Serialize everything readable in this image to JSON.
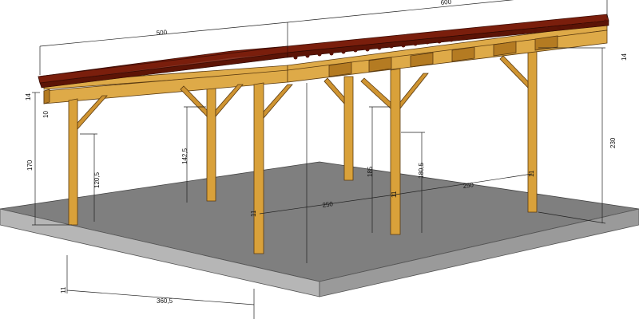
{
  "drawing": {
    "dims": {
      "roof_left_length": "500",
      "roof_right_length": "600",
      "beam_height_left": "14",
      "beam_width_left": "10",
      "post_height_left": "170",
      "brace_height_left": "120,5",
      "brace_height_mid": "142,5",
      "post_height_right": "230",
      "beam_height_right": "14",
      "span_front": "250",
      "span_right": "250",
      "post_height_center": "185",
      "brace_height_center": "180,5",
      "post_size_a": "11",
      "post_size_b": "11",
      "post_size_c": "11",
      "post_size_d": "11",
      "bottom_size": "11",
      "bottom_length": "360,5"
    },
    "colors": {
      "wood": "#d9a13a",
      "roof": "#7a1e0c",
      "slab": "#7f7f7f"
    }
  }
}
